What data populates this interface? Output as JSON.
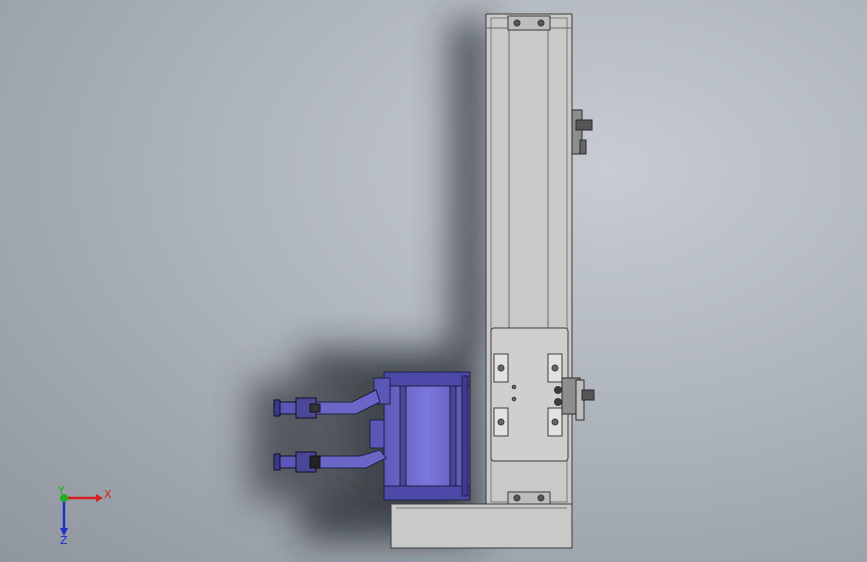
{
  "triad": {
    "x_label": "X",
    "y_label": "Y",
    "z_label": "Z"
  },
  "colors": {
    "background": "#aeb4bc",
    "frame": "#c8c8c8",
    "outline": "#3c3c3c",
    "motor": "#6a67c9",
    "motor_dark": "#4c49a8",
    "x_axis": "#d42020",
    "y_axis": "#20b020",
    "z_axis": "#2030d0"
  },
  "icons": {
    "triad": "view-orientation-triad-icon"
  }
}
